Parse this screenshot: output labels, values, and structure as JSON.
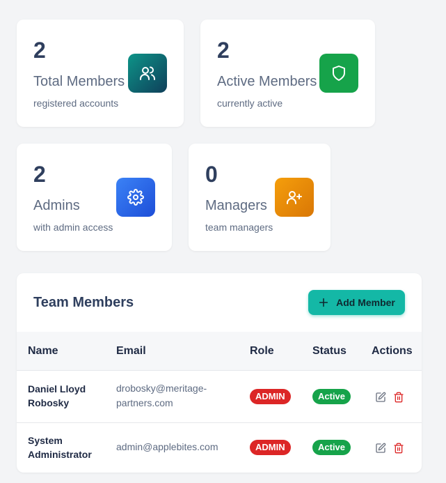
{
  "stats": [
    {
      "value": "2",
      "label": "Total Members",
      "sub": "registered accounts",
      "icon": "users-icon",
      "color": "#0d9488"
    },
    {
      "value": "2",
      "label": "Active Members",
      "sub": "currently active",
      "icon": "shield-icon",
      "color": "#16a34a"
    },
    {
      "value": "2",
      "label": "Admins",
      "sub": "with admin access",
      "icon": "gear-icon",
      "color": "#2563eb"
    },
    {
      "value": "0",
      "label": "Managers",
      "sub": "team managers",
      "icon": "user-plus-icon",
      "color": "#f59e0b"
    }
  ],
  "members": {
    "title": "Team Members",
    "add_label": "Add Member",
    "columns": [
      "Name",
      "Email",
      "Role",
      "Status",
      "Actions"
    ],
    "rows": [
      {
        "name": "Daniel Lloyd Robosky",
        "email": "drobosky@meritage-partners.com",
        "role": "ADMIN",
        "status": "Active"
      },
      {
        "name": "System Administrator",
        "email": "admin@applebites.com",
        "role": "ADMIN",
        "status": "Active"
      }
    ]
  },
  "colors": {
    "accent": "#14b8a6",
    "admin_badge": "#dc2626",
    "active_badge": "#16a34a"
  }
}
